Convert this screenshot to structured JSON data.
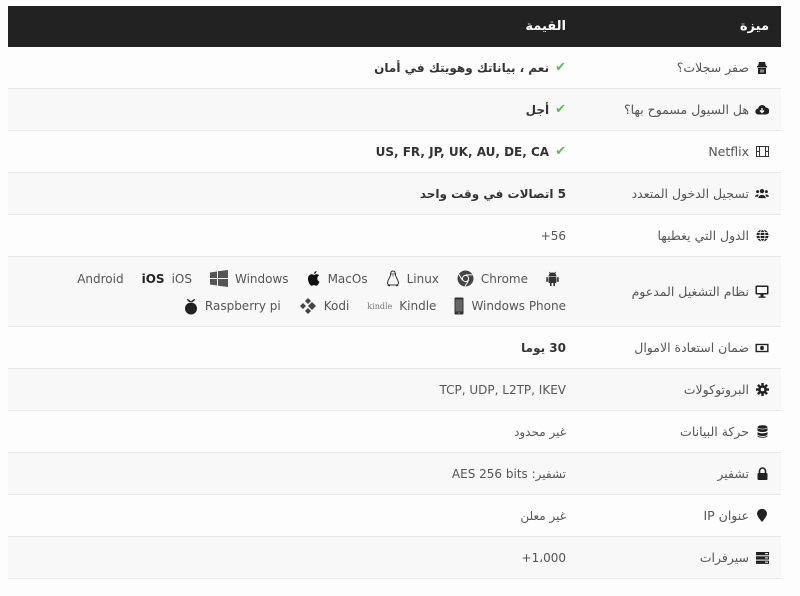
{
  "header": {
    "feature": "ميزة",
    "value": "القيمة"
  },
  "colors": {
    "header_bg": "#222222",
    "check": "#5cb85c",
    "row_alt": "#f8f8f8"
  },
  "rows": [
    {
      "feature": "صفر سجلات؟",
      "icon": "user-secret-icon",
      "value": "نعم ، بياناتك وهويتك في أمان",
      "check": true,
      "bold": true
    },
    {
      "feature": "هل السيول مسموح بها؟",
      "icon": "cloud-download-icon",
      "value": "أجل",
      "check": true,
      "bold": true
    },
    {
      "feature": "Netflix",
      "icon": "film-icon",
      "value": "US, FR, JP, UK, AU, DE, CA",
      "check": true,
      "bold": true
    },
    {
      "feature": "تسجيل الدخول المتعدد",
      "icon": "users-icon",
      "value": "5 اتصالات في وقت واحد",
      "bold": true
    },
    {
      "feature": "الدول التي يغطيها",
      "icon": "globe-icon",
      "value": "+56"
    },
    {
      "feature": "نظام التشغيل المدعوم",
      "icon": "desktop-icon",
      "os_line1": [
        {
          "label": "",
          "icon": "android-icon"
        },
        {
          "label": "Chrome",
          "icon": "chrome-icon"
        },
        {
          "label": "Linux",
          "icon": "linux-icon"
        },
        {
          "label": "MacOs",
          "icon": "apple-icon"
        },
        {
          "label": "Windows",
          "icon": "windows-icon"
        },
        {
          "label": "iOS",
          "icon": "ios-text-icon",
          "icon_text": "iOS"
        },
        {
          "label": "Android",
          "icon": "android-text"
        }
      ],
      "os_line2": [
        {
          "label": "Windows Phone",
          "icon": "windows-phone-icon"
        },
        {
          "label": "Kindle",
          "icon": "kindle-icon",
          "icon_text": "kindle"
        },
        {
          "label": "Kodi",
          "icon": "kodi-icon"
        },
        {
          "label": "Raspberry pi",
          "icon": "raspberry-pi-icon"
        }
      ]
    },
    {
      "feature": "ضمان استعادة الاموال",
      "icon": "money-icon",
      "value": "30 يوما",
      "bold": true
    },
    {
      "feature": "البروتوكولات",
      "icon": "gear-icon",
      "value": "TCP, UDP, L2TP, IKEV"
    },
    {
      "feature": "حركة البيانات",
      "icon": "database-icon",
      "value": "غير محدود"
    },
    {
      "feature": "تشفير",
      "icon": "lock-icon",
      "value": "تشفير: AES 256 bits"
    },
    {
      "feature": "عنوان IP",
      "icon": "map-marker-icon",
      "value": "غير معلن"
    },
    {
      "feature": "سيرفرات",
      "icon": "server-icon",
      "value": "+1،000"
    }
  ]
}
